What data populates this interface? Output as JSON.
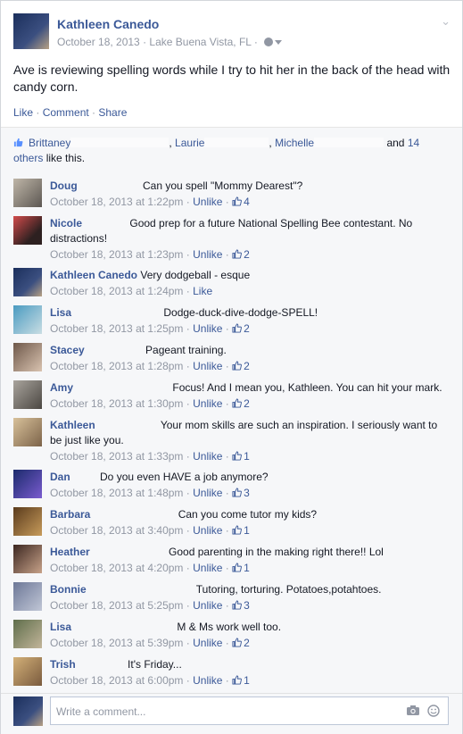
{
  "post": {
    "author": "Kathleen Canedo",
    "date": "October 18, 2013",
    "separator": "·",
    "location": "Lake Buena Vista, FL",
    "text": "Ave is reviewing spelling words while I try to hit her in the back of the head with candy corn.",
    "actions": {
      "like": "Like",
      "comment": "Comment",
      "share": "Share",
      "sep": " · "
    }
  },
  "likes": {
    "name1": "Brittaney",
    "name2": "Laurie",
    "name3": "Michelle",
    "comma": ",",
    "and": "and",
    "others_link": "14 others",
    "suffix": "like this."
  },
  "comments": [
    {
      "name": "Doug",
      "text": "Can you spell \"Mommy Dearest\"?",
      "time": "October 18, 2013 at 1:22pm",
      "unlike": "Unlike",
      "likes": "4"
    },
    {
      "name": "Nicole",
      "text": "Good prep for a future National Spelling Bee contestant. No distractions!",
      "time": "October 18, 2013 at 1:23pm",
      "unlike": "Unlike",
      "likes": "2"
    },
    {
      "name": "Kathleen Canedo",
      "text": "Very dodgeball - esque",
      "time": "October 18, 2013 at 1:24pm",
      "like": "Like"
    },
    {
      "name": "Lisa",
      "text": "Dodge-duck-dive-dodge-SPELL!",
      "time": "October 18, 2013 at 1:25pm",
      "unlike": "Unlike",
      "likes": "2"
    },
    {
      "name": "Stacey",
      "text": "Pageant training.",
      "time": "October 18, 2013 at 1:28pm",
      "unlike": "Unlike",
      "likes": "2"
    },
    {
      "name": "Amy",
      "text": "Focus! And I mean you, Kathleen. You can hit your mark.",
      "time": "October 18, 2013 at 1:30pm",
      "unlike": "Unlike",
      "likes": "2"
    },
    {
      "name": "Kathleen",
      "text": "Your mom skills are such an inspiration. I seriously want to be just like you.",
      "time": "October 18, 2013 at 1:33pm",
      "unlike": "Unlike",
      "likes": "1"
    },
    {
      "name": "Dan",
      "text": "Do you even HAVE a job anymore?",
      "time": "October 18, 2013 at 1:48pm",
      "unlike": "Unlike",
      "likes": "3"
    },
    {
      "name": "Barbara",
      "text": "Can you come tutor my kids?",
      "time": "October 18, 2013 at 3:40pm",
      "unlike": "Unlike",
      "likes": "1"
    },
    {
      "name": "Heather",
      "text": "Good parenting in the making right there!! Lol",
      "time": "October 18, 2013 at 4:20pm",
      "unlike": "Unlike",
      "likes": "1"
    },
    {
      "name": "Bonnie",
      "text": "Tutoring, torturing. Potatoes,potahtoes.",
      "time": "October 18, 2013 at 5:25pm",
      "unlike": "Unlike",
      "likes": "3"
    },
    {
      "name": "Lisa",
      "text": "M & Ms work well too.",
      "time": "October 18, 2013 at 5:39pm",
      "unlike": "Unlike",
      "likes": "2"
    },
    {
      "name": "Trish",
      "text": "It's Friday...",
      "time": "October 18, 2013 at 6:00pm",
      "unlike": "Unlike",
      "likes": "1"
    }
  ],
  "composer": {
    "placeholder": "Write a comment..."
  },
  "colors": {
    "link": "#3b5998",
    "meta": "#9197a3",
    "ufi_bg": "#f6f7f9"
  },
  "icons": [
    "globe-icon",
    "caret-down-icon",
    "chevron-down-icon",
    "thumbs-up-icon",
    "camera-icon",
    "smiley-icon"
  ]
}
